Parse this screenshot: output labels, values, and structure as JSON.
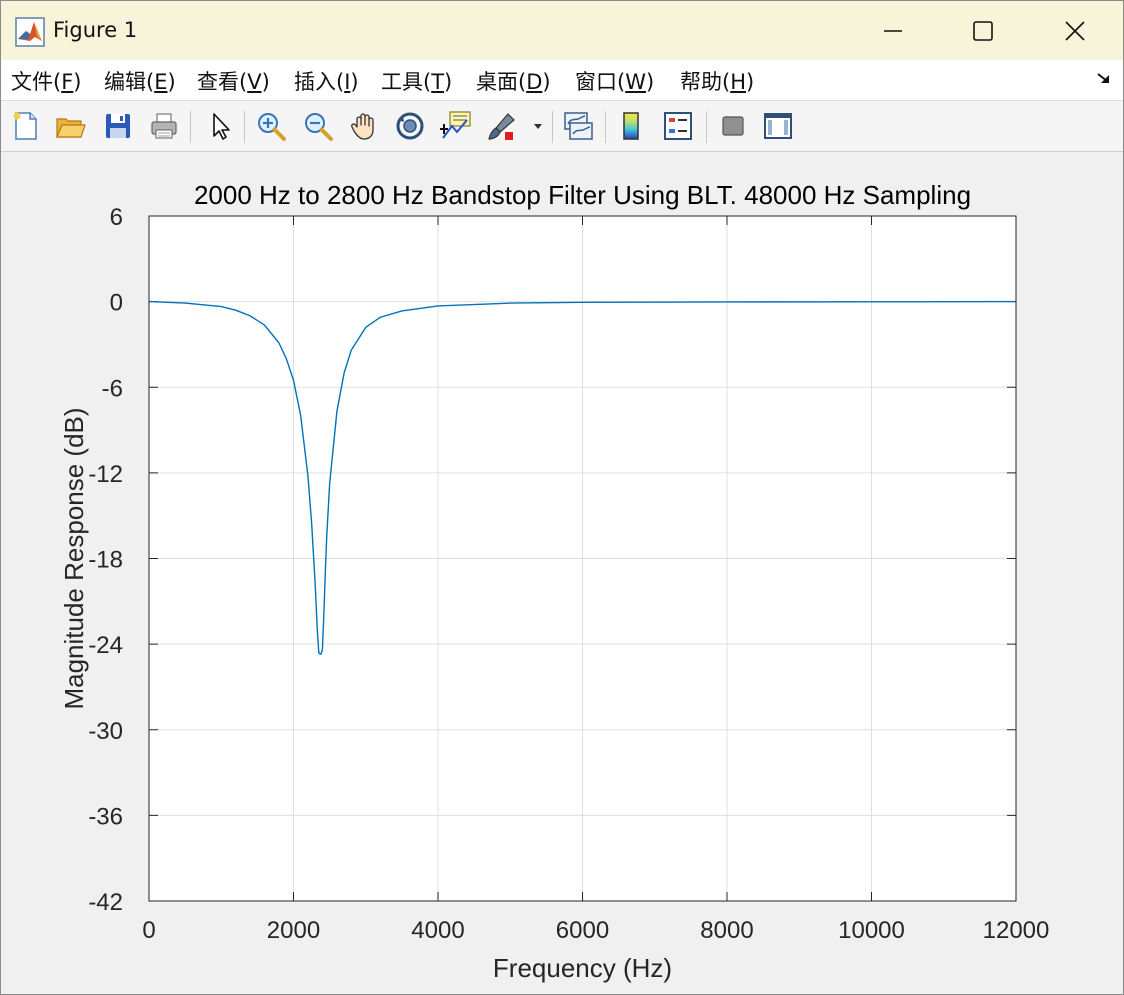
{
  "window": {
    "title": "Figure 1"
  },
  "menu": [
    {
      "label": "文件(",
      "hotkey": "F",
      "close": ")"
    },
    {
      "label": "编辑(",
      "hotkey": "E",
      "close": ")"
    },
    {
      "label": "查看(",
      "hotkey": "V",
      "close": ")"
    },
    {
      "label": "插入(",
      "hotkey": "I",
      "close": ")"
    },
    {
      "label": "工具(",
      "hotkey": "T",
      "close": ")"
    },
    {
      "label": "桌面(",
      "hotkey": "D",
      "close": ")"
    },
    {
      "label": "窗口(",
      "hotkey": "W",
      "close": ")"
    },
    {
      "label": "帮助(",
      "hotkey": "H",
      "close": ")"
    }
  ],
  "toolbar": {
    "icons": [
      "new-figure-icon",
      "open-file-icon",
      "save-icon",
      "print-icon",
      "select-arrow-icon",
      "zoom-in-icon",
      "zoom-out-icon",
      "pan-hand-icon",
      "rotate-3d-icon",
      "data-cursor-icon",
      "brush-icon",
      "brush-dropdown-icon",
      "link-plot-icon",
      "colorbar-icon",
      "legend-icon",
      "hide-plot-tools-icon",
      "show-plot-tools-icon"
    ]
  },
  "colors": {
    "line": "#0072bd",
    "grid": "#dfdfdf",
    "axes_bg": "#ffffff",
    "figure_bg": "#f0f0f0"
  },
  "chart_data": {
    "type": "line",
    "title": "2000 Hz to 2800 Hz Bandstop Filter Using BLT. 48000 Hz Sampling",
    "xlabel": "Frequency (Hz)",
    "ylabel": "Magnitude Response (dB)",
    "xlim": [
      0,
      12000
    ],
    "ylim": [
      -42,
      6
    ],
    "xticks": [
      0,
      2000,
      4000,
      6000,
      8000,
      10000,
      12000
    ],
    "yticks": [
      -42,
      -36,
      -30,
      -24,
      -18,
      -12,
      -6,
      0,
      6
    ],
    "grid": true,
    "series": [
      {
        "x": [
          0,
          500,
          1000,
          1200,
          1400,
          1600,
          1800,
          1900,
          2000,
          2100,
          2200,
          2250,
          2300,
          2330,
          2350,
          2370,
          2380,
          2400,
          2420,
          2440,
          2460,
          2500,
          2600,
          2700,
          2800,
          3000,
          3200,
          3500,
          4000,
          5000,
          6000,
          8000,
          10000,
          12000
        ],
        "y": [
          0,
          -0.1,
          -0.35,
          -0.6,
          -1.0,
          -1.65,
          -2.9,
          -4.0,
          -5.5,
          -8.0,
          -12.2,
          -15.5,
          -19.8,
          -23.0,
          -24.6,
          -24.7,
          -24.7,
          -24.4,
          -22.0,
          -19.0,
          -16.5,
          -12.8,
          -7.7,
          -5.0,
          -3.4,
          -1.8,
          -1.1,
          -0.65,
          -0.3,
          -0.1,
          -0.05,
          -0.02,
          -0.01,
          0
        ]
      }
    ]
  }
}
